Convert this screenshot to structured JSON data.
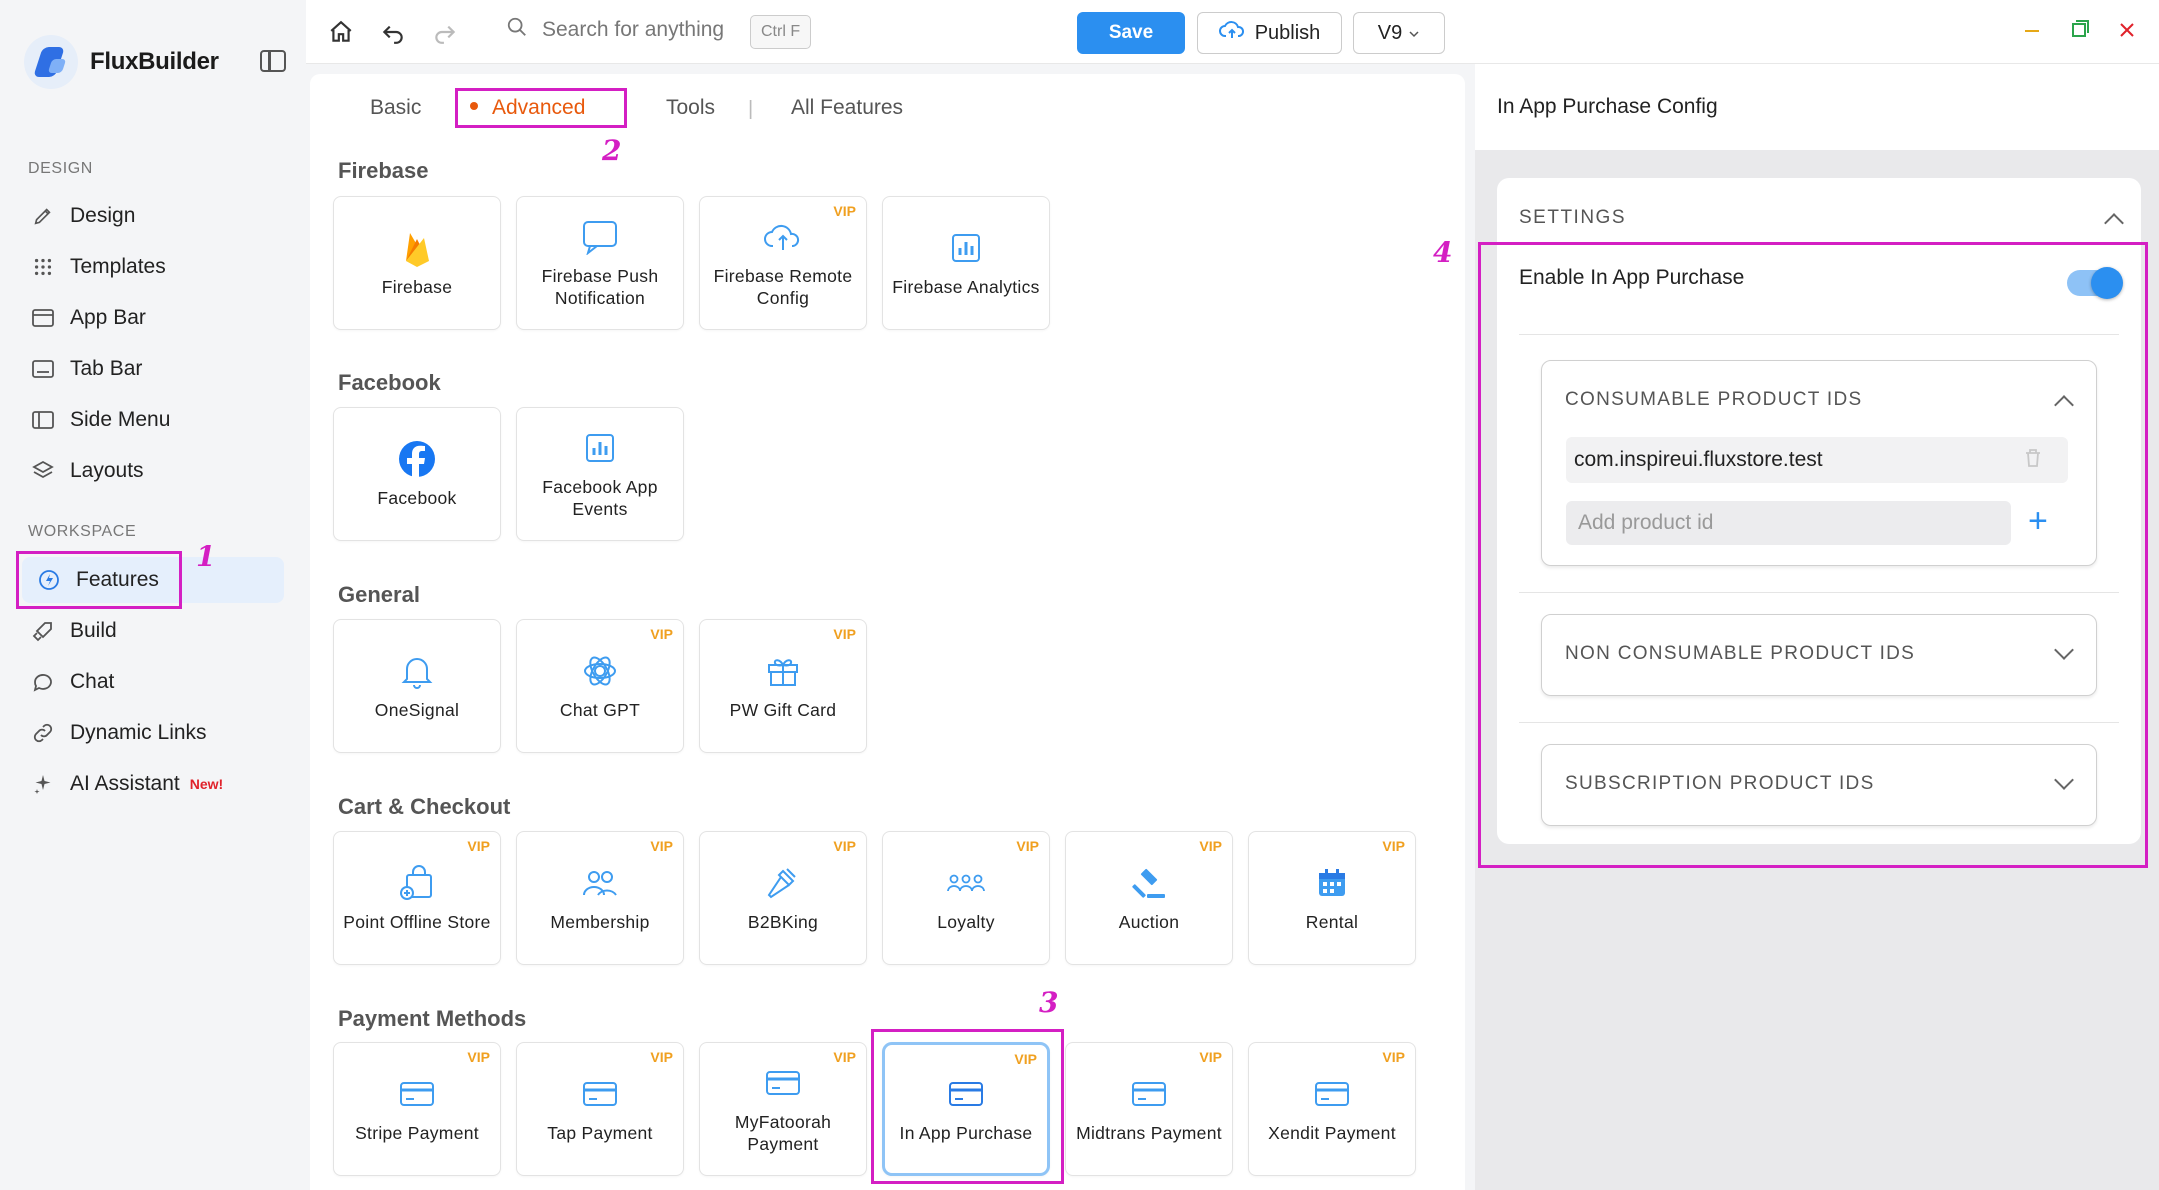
{
  "app": {
    "name": "FluxBuilder"
  },
  "sidebar": {
    "design_label": "DESIGN",
    "workspace_label": "WORKSPACE",
    "items": [
      {
        "label": "Design",
        "icon": "brush-icon"
      },
      {
        "label": "Templates",
        "icon": "grid-icon"
      },
      {
        "label": "App Bar",
        "icon": "app-bar-icon"
      },
      {
        "label": "Tab Bar",
        "icon": "tab-bar-icon"
      },
      {
        "label": "Side Menu",
        "icon": "side-menu-icon"
      },
      {
        "label": "Layouts",
        "icon": "layers-icon"
      },
      {
        "label": "Features",
        "icon": "lightning-icon"
      },
      {
        "label": "Build",
        "icon": "rocket-icon"
      },
      {
        "label": "Chat",
        "icon": "chat-icon"
      },
      {
        "label": "Dynamic Links",
        "icon": "link-icon"
      },
      {
        "label": "AI Assistant",
        "icon": "sparkle-icon",
        "badge": "New!"
      }
    ]
  },
  "topbar": {
    "search_placeholder": "Search for anything",
    "shortcut": "Ctrl F",
    "save_label": "Save",
    "publish_label": "Publish",
    "version": "V9"
  },
  "tabs": [
    {
      "label": "Basic"
    },
    {
      "label": "Advanced"
    },
    {
      "label": "Tools"
    },
    {
      "label": "All Features"
    }
  ],
  "tab_separator": "|",
  "groups": [
    {
      "title": "Firebase",
      "cards": [
        {
          "label": "Firebase",
          "icon": "firebase-icon",
          "vip": ""
        },
        {
          "label": "Firebase Push Notification",
          "icon": "message-icon",
          "vip": ""
        },
        {
          "label": "Firebase Remote Config",
          "icon": "cloud-sync-icon",
          "vip": "VIP"
        },
        {
          "label": "Firebase Analytics",
          "icon": "analytics-icon",
          "vip": ""
        }
      ]
    },
    {
      "title": "Facebook",
      "cards": [
        {
          "label": "Facebook",
          "icon": "facebook-icon",
          "vip": ""
        },
        {
          "label": "Facebook App Events",
          "icon": "analytics-icon",
          "vip": ""
        }
      ]
    },
    {
      "title": "General",
      "cards": [
        {
          "label": "OneSignal",
          "icon": "bell-icon",
          "vip": ""
        },
        {
          "label": "Chat GPT",
          "icon": "openai-icon",
          "vip": "VIP"
        },
        {
          "label": "PW Gift Card",
          "icon": "gift-icon",
          "vip": "VIP"
        }
      ]
    },
    {
      "title": "Cart & Checkout",
      "cards": [
        {
          "label": "Point Offline Store",
          "icon": "store-bag-icon",
          "vip": "VIP"
        },
        {
          "label": "Membership",
          "icon": "users-icon",
          "vip": "VIP"
        },
        {
          "label": "B2BKing",
          "icon": "hammer-icon",
          "vip": "VIP"
        },
        {
          "label": "Loyalty",
          "icon": "group-icon",
          "vip": "VIP"
        },
        {
          "label": "Auction",
          "icon": "gavel-icon",
          "vip": "VIP"
        },
        {
          "label": "Rental",
          "icon": "calendar-icon",
          "vip": "VIP"
        }
      ]
    },
    {
      "title": "Payment Methods",
      "cards": [
        {
          "label": "Stripe Payment",
          "icon": "card-icon",
          "vip": "VIP"
        },
        {
          "label": "Tap Payment",
          "icon": "card-icon",
          "vip": "VIP"
        },
        {
          "label": "MyFatoorah Payment",
          "icon": "card-icon",
          "vip": "VIP"
        },
        {
          "label": "In App Purchase",
          "icon": "card-icon",
          "vip": "VIP"
        },
        {
          "label": "Midtrans Payment",
          "icon": "card-icon",
          "vip": "VIP"
        },
        {
          "label": "Xendit Payment",
          "icon": "card-icon",
          "vip": "VIP"
        }
      ]
    }
  ],
  "config": {
    "title": "In App Purchase Config",
    "settings_label": "SETTINGS",
    "enable_label": "Enable In App Purchase",
    "enabled": true,
    "consumable_label": "CONSUMABLE PRODUCT IDS",
    "consumable_ids": [
      "com.inspireui.fluxstore.test"
    ],
    "add_placeholder": "Add product id",
    "add_symbol": "+",
    "non_consumable_label": "NON CONSUMABLE PRODUCT IDS",
    "subscription_label": "SUBSCRIPTION PRODUCT IDS"
  },
  "annotations": [
    "1",
    "2",
    "3",
    "4"
  ],
  "colors": {
    "accent": "#2b8ff0",
    "active_tab": "#e8590c",
    "vip": "#f0a020",
    "annotation": "#d41fc3",
    "new_badge": "#e0222b"
  }
}
